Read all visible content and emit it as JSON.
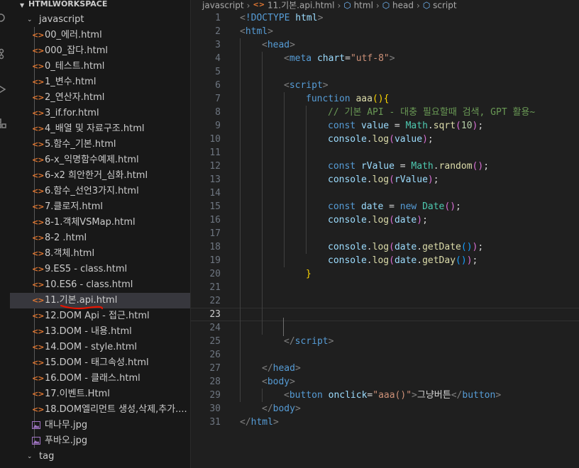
{
  "explorer": {
    "workspace_title": "HTMLWORKSPACE",
    "folder_javascript": "javascript",
    "folder_tag": "tag",
    "files": [
      {
        "name": "00_에러.html",
        "type": "html"
      },
      {
        "name": "000_잡다.html",
        "type": "html"
      },
      {
        "name": "0_테스트.html",
        "type": "html"
      },
      {
        "name": "1_변수.html",
        "type": "html"
      },
      {
        "name": "2_연산자.html",
        "type": "html"
      },
      {
        "name": "3_if.for.html",
        "type": "html"
      },
      {
        "name": "4_배열 및 자료구조.html",
        "type": "html"
      },
      {
        "name": "5.함수_기본.html",
        "type": "html"
      },
      {
        "name": "6-x_익명함수예제.html",
        "type": "html"
      },
      {
        "name": "6-x2 희안한거_심화.html",
        "type": "html"
      },
      {
        "name": "6.함수_선언3가지.html",
        "type": "html"
      },
      {
        "name": "7.클로저.html",
        "type": "html"
      },
      {
        "name": "8-1.객체VSMap.html",
        "type": "html"
      },
      {
        "name": "8-2 .html",
        "type": "html"
      },
      {
        "name": "8.객체.html",
        "type": "html"
      },
      {
        "name": "9.ES5 - class.html",
        "type": "html"
      },
      {
        "name": "10.ES6 - class.html",
        "type": "html"
      },
      {
        "name": "11.기본.api.html",
        "type": "html",
        "selected": true
      },
      {
        "name": "12.DOM Api - 접근.html",
        "type": "html"
      },
      {
        "name": "13.DOM - 내용.html",
        "type": "html"
      },
      {
        "name": "14.DOM - style.html",
        "type": "html"
      },
      {
        "name": "15.DOM - 태그속성.html",
        "type": "html"
      },
      {
        "name": "16.DOM - 클래스.html",
        "type": "html"
      },
      {
        "name": "17.이벤트.Html",
        "type": "html"
      },
      {
        "name": "18.DOM엘리먼트 생성,삭제,추가....",
        "type": "html"
      },
      {
        "name": "대나무.jpg",
        "type": "image"
      },
      {
        "name": "푸바오.jpg",
        "type": "image"
      }
    ]
  },
  "breadcrumb": {
    "folder": "javascript",
    "file": "11.기본.api.html",
    "sym1": "html",
    "sym2": "head",
    "sym3": "script"
  },
  "editor": {
    "current_line": 23,
    "lines": [
      {
        "n": "1",
        "indent": 0,
        "tokens": [
          [
            "b",
            "<"
          ],
          [
            "tg",
            "!DOCTYPE"
          ],
          [
            "t",
            " "
          ],
          [
            "at",
            "html"
          ],
          [
            "b",
            ">"
          ]
        ]
      },
      {
        "n": "2",
        "indent": 0,
        "tokens": [
          [
            "b",
            "<"
          ],
          [
            "tg",
            "html"
          ],
          [
            "b",
            ">"
          ]
        ]
      },
      {
        "n": "3",
        "indent": 1,
        "tokens": [
          [
            "b",
            "<"
          ],
          [
            "tg",
            "head"
          ],
          [
            "b",
            ">"
          ]
        ]
      },
      {
        "n": "4",
        "indent": 2,
        "tokens": [
          [
            "b",
            "<"
          ],
          [
            "tg",
            "meta"
          ],
          [
            "t",
            " "
          ],
          [
            "at",
            "chart"
          ],
          [
            "t",
            "="
          ],
          [
            "s",
            "\"utf-8\""
          ],
          [
            "b",
            ">"
          ]
        ]
      },
      {
        "n": "5",
        "indent": 0,
        "tokens": []
      },
      {
        "n": "6",
        "indent": 2,
        "tokens": [
          [
            "b",
            "<"
          ],
          [
            "tg",
            "script"
          ],
          [
            "b",
            ">"
          ]
        ]
      },
      {
        "n": "7",
        "indent": 3,
        "tokens": [
          [
            "k",
            "function"
          ],
          [
            "t",
            " "
          ],
          [
            "f",
            "aaa"
          ],
          [
            "br",
            "(){"
          ]
        ]
      },
      {
        "n": "8",
        "indent": 4,
        "tokens": [
          [
            "c",
            "// 기본 API - 대충 필요할때 검색, GPT 활용~"
          ]
        ]
      },
      {
        "n": "9",
        "indent": 4,
        "tokens": [
          [
            "k",
            "const"
          ],
          [
            "t",
            " "
          ],
          [
            "v",
            "value"
          ],
          [
            "t",
            " = "
          ],
          [
            "cl",
            "Math"
          ],
          [
            "t",
            "."
          ],
          [
            "f",
            "sqrt"
          ],
          [
            "p",
            "("
          ],
          [
            "nm",
            "10"
          ],
          [
            "p",
            ")"
          ],
          [
            "t",
            ";"
          ]
        ]
      },
      {
        "n": "10",
        "indent": 4,
        "tokens": [
          [
            "v",
            "console"
          ],
          [
            "t",
            "."
          ],
          [
            "f",
            "log"
          ],
          [
            "p",
            "("
          ],
          [
            "v",
            "value"
          ],
          [
            "p",
            ")"
          ],
          [
            "t",
            ";"
          ]
        ]
      },
      {
        "n": "11",
        "indent": 0,
        "tokens": []
      },
      {
        "n": "12",
        "indent": 4,
        "tokens": [
          [
            "k",
            "const"
          ],
          [
            "t",
            " "
          ],
          [
            "v",
            "rValue"
          ],
          [
            "t",
            " = "
          ],
          [
            "cl",
            "Math"
          ],
          [
            "t",
            "."
          ],
          [
            "f",
            "random"
          ],
          [
            "p",
            "()"
          ],
          [
            "t",
            ";"
          ]
        ]
      },
      {
        "n": "13",
        "indent": 4,
        "tokens": [
          [
            "v",
            "console"
          ],
          [
            "t",
            "."
          ],
          [
            "f",
            "log"
          ],
          [
            "p",
            "("
          ],
          [
            "v",
            "rValue"
          ],
          [
            "p",
            ")"
          ],
          [
            "t",
            ";"
          ]
        ]
      },
      {
        "n": "14",
        "indent": 0,
        "tokens": []
      },
      {
        "n": "15",
        "indent": 4,
        "tokens": [
          [
            "k",
            "const"
          ],
          [
            "t",
            " "
          ],
          [
            "v",
            "date"
          ],
          [
            "t",
            " = "
          ],
          [
            "k",
            "new"
          ],
          [
            "t",
            " "
          ],
          [
            "cl",
            "Date"
          ],
          [
            "p",
            "()"
          ],
          [
            "t",
            ";"
          ]
        ]
      },
      {
        "n": "16",
        "indent": 4,
        "tokens": [
          [
            "v",
            "console"
          ],
          [
            "t",
            "."
          ],
          [
            "f",
            "log"
          ],
          [
            "p",
            "("
          ],
          [
            "v",
            "date"
          ],
          [
            "p",
            ")"
          ],
          [
            "t",
            ";"
          ]
        ]
      },
      {
        "n": "17",
        "indent": 0,
        "tokens": []
      },
      {
        "n": "18",
        "indent": 4,
        "tokens": [
          [
            "v",
            "console"
          ],
          [
            "t",
            "."
          ],
          [
            "f",
            "log"
          ],
          [
            "p",
            "("
          ],
          [
            "v",
            "date"
          ],
          [
            "t",
            "."
          ],
          [
            "f",
            "getDate"
          ],
          [
            "p2",
            "()"
          ],
          [
            "p",
            ")"
          ],
          [
            "t",
            ";"
          ]
        ]
      },
      {
        "n": "19",
        "indent": 4,
        "tokens": [
          [
            "v",
            "console"
          ],
          [
            "t",
            "."
          ],
          [
            "f",
            "log"
          ],
          [
            "p",
            "("
          ],
          [
            "v",
            "date"
          ],
          [
            "t",
            "."
          ],
          [
            "f",
            "getDay"
          ],
          [
            "p2",
            "()"
          ],
          [
            "p",
            ")"
          ],
          [
            "t",
            ";"
          ]
        ]
      },
      {
        "n": "20",
        "indent": 3,
        "tokens": [
          [
            "br",
            "}"
          ]
        ]
      },
      {
        "n": "21",
        "indent": 0,
        "tokens": []
      },
      {
        "n": "22",
        "indent": 0,
        "tokens": []
      },
      {
        "n": "23",
        "indent": 0,
        "tokens": []
      },
      {
        "n": "24",
        "indent": 0,
        "tokens": []
      },
      {
        "n": "25",
        "indent": 2,
        "tokens": [
          [
            "b",
            "</"
          ],
          [
            "tg",
            "script"
          ],
          [
            "b",
            ">"
          ]
        ]
      },
      {
        "n": "26",
        "indent": 0,
        "tokens": []
      },
      {
        "n": "27",
        "indent": 1,
        "tokens": [
          [
            "b",
            "</"
          ],
          [
            "tg",
            "head"
          ],
          [
            "b",
            ">"
          ]
        ]
      },
      {
        "n": "28",
        "indent": 1,
        "tokens": [
          [
            "b",
            "<"
          ],
          [
            "tg",
            "body"
          ],
          [
            "b",
            ">"
          ]
        ]
      },
      {
        "n": "29",
        "indent": 2,
        "tokens": [
          [
            "b",
            "<"
          ],
          [
            "tg",
            "button"
          ],
          [
            "t",
            " "
          ],
          [
            "at",
            "onclick"
          ],
          [
            "t",
            "="
          ],
          [
            "s",
            "\"aaa()\""
          ],
          [
            "b",
            ">"
          ],
          [
            "t",
            "그냥버튼"
          ],
          [
            "b",
            "</"
          ],
          [
            "tg",
            "button"
          ],
          [
            "b",
            ">"
          ]
        ]
      },
      {
        "n": "30",
        "indent": 1,
        "tokens": [
          [
            "b",
            "</"
          ],
          [
            "tg",
            "body"
          ],
          [
            "b",
            ">"
          ]
        ]
      },
      {
        "n": "31",
        "indent": 0,
        "tokens": [
          [
            "b",
            "</"
          ],
          [
            "tg",
            "html"
          ],
          [
            "b",
            ">"
          ]
        ]
      }
    ]
  },
  "colors": {
    "accent_underline": "#e51400",
    "html_icon": "#e37933",
    "selected_row": "#37373d"
  }
}
